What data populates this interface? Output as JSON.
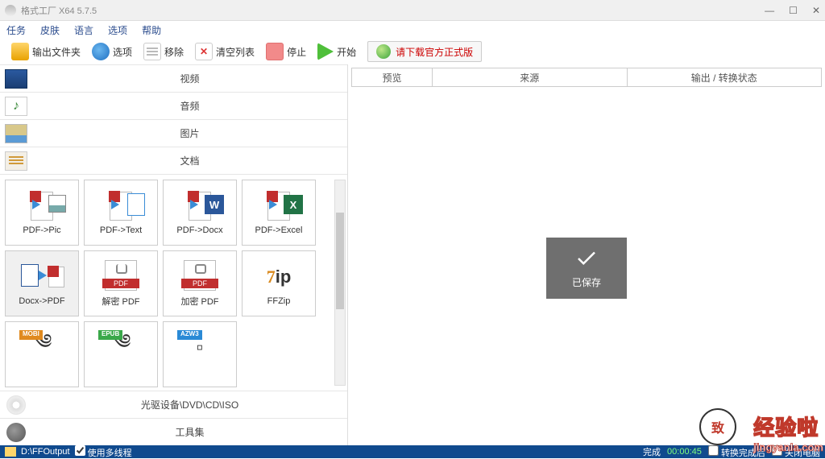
{
  "window": {
    "title": "格式工厂 X64 5.7.5"
  },
  "menu": [
    "任务",
    "皮肤",
    "语言",
    "选项",
    "帮助"
  ],
  "toolbar": {
    "output_folder": "输出文件夹",
    "options": "选项",
    "remove": "移除",
    "clear_list": "清空列表",
    "stop": "停止",
    "start": "开始",
    "download_official": "请下载官方正式版"
  },
  "categories": {
    "video": "视频",
    "audio": "音频",
    "image": "图片",
    "document": "文档",
    "optical": "光驱设备\\DVD\\CD\\ISO",
    "toolset": "工具集"
  },
  "tiles": [
    {
      "label": "PDF->Pic"
    },
    {
      "label": "PDF->Text"
    },
    {
      "label": "PDF->Docx"
    },
    {
      "label": "PDF->Excel"
    },
    {
      "label": "Docx->PDF"
    },
    {
      "label": "解密 PDF"
    },
    {
      "label": "加密 PDF"
    },
    {
      "label": "FFZip"
    },
    {
      "label": "MOBI"
    },
    {
      "label": "EPUB"
    },
    {
      "label": "AZW3"
    }
  ],
  "table": {
    "preview": "预览",
    "source": "来源",
    "status": "输出 / 转换状态"
  },
  "toast": "已保存",
  "statusbar": {
    "output_path": "D:\\FFOutput",
    "multithread": "使用多线程",
    "done": "完成",
    "elapsed": "00:00:45",
    "after_convert": "转换完成后",
    "shutdown": "关闭电脑"
  },
  "watermark": {
    "text": "经验啦",
    "url": "jingyanla.com"
  }
}
